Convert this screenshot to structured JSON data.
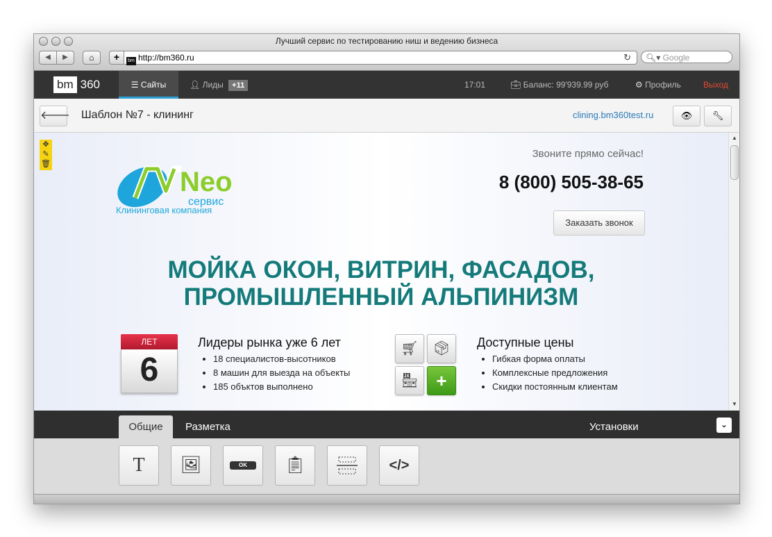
{
  "browser": {
    "window_title": "Лучший сервис по тестированию ниш и ведению бизнеса",
    "url": "http://bm360.ru",
    "favicon_text": "bm",
    "search_placeholder": "Google",
    "icons": {
      "back": "back-arrow-icon",
      "forward": "forward-arrow-icon",
      "home": "home-icon",
      "add": "plus-icon",
      "reload": "reload-icon",
      "search": "search-icon"
    }
  },
  "app_nav": {
    "logo_bm": "bm",
    "logo_num": "360",
    "sites_label": "Сайты",
    "leads_label": "Лиды",
    "leads_badge": "+11",
    "time": "17:01",
    "balance": "Баланс: 99'939.99 руб",
    "profile": "Профиль",
    "logout": "Выход",
    "logout_color": "#e34a2f",
    "accent_color": "#2b9fd6"
  },
  "page_header": {
    "title": "Шаблон №7 - клининг",
    "site_link": "clining.bm360test.ru"
  },
  "site": {
    "logo_text": "Neo",
    "logo_sub": "сервис",
    "company": "Клининговая компания",
    "call_now": "Звоните прямо сейчас!",
    "phone": "8 (800) 505-38-65",
    "call_button": "Заказать звонок",
    "headline_line1": "МОЙКА ОКОН, ВИТРИН, ФАСАДОВ,",
    "headline_line2": "ПРОМЫШЛЕННЫЙ АЛЬПИНИЗМ",
    "headline_color": "#147a7a",
    "calendar_top": "ЛЕТ",
    "calendar_num": "6",
    "feature1": {
      "title": "Лидеры рынка уже 6 лет",
      "items": [
        "18 специалистов-высотников",
        "8 машин для выезда на объекты",
        "185 объктов выполнено"
      ]
    },
    "feature2": {
      "title": "Доступные цены",
      "items": [
        "Гибкая форма оплаты",
        "Комплексные предложения",
        "Скидки постоянным клиентам"
      ]
    }
  },
  "bottom_panel": {
    "tab_general": "Общие",
    "tab_markup": "Разметка",
    "settings": "Установки",
    "block_text_label": "T",
    "block_button_label": "OK"
  }
}
